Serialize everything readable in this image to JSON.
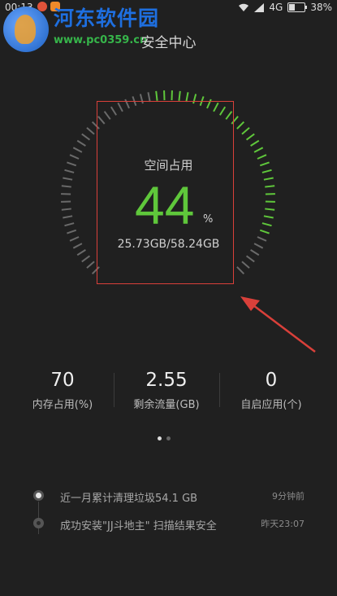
{
  "status_bar": {
    "time": "00:13",
    "network": "4G",
    "battery": "38%",
    "battery_level": 0.38
  },
  "watermark": {
    "title": "河东软件园",
    "url": "www.pc0359.cn"
  },
  "header": {
    "title": "安全中心"
  },
  "gauge": {
    "label": "空间占用",
    "value": "44",
    "unit": "%",
    "capacity": "25.73GB/58.24GB",
    "percent": 44,
    "accent_color": "#5fc73b",
    "tick_color": "#6a6a6a"
  },
  "stats": [
    {
      "value": "70",
      "label": "内存占用(%)"
    },
    {
      "value": "2.55",
      "label": "剩余流量(GB)"
    },
    {
      "value": "0",
      "label": "自启应用(个)"
    }
  ],
  "pager": {
    "pages": 2,
    "current": 1
  },
  "timeline": [
    {
      "text": "近一月累计清理垃圾54.1 GB",
      "time": "9分钟前"
    },
    {
      "text": "成功安装\"JJ斗地主\" 扫描结果安全",
      "time": "昨天23:07"
    }
  ],
  "annotation": {
    "color": "#d9403a"
  }
}
